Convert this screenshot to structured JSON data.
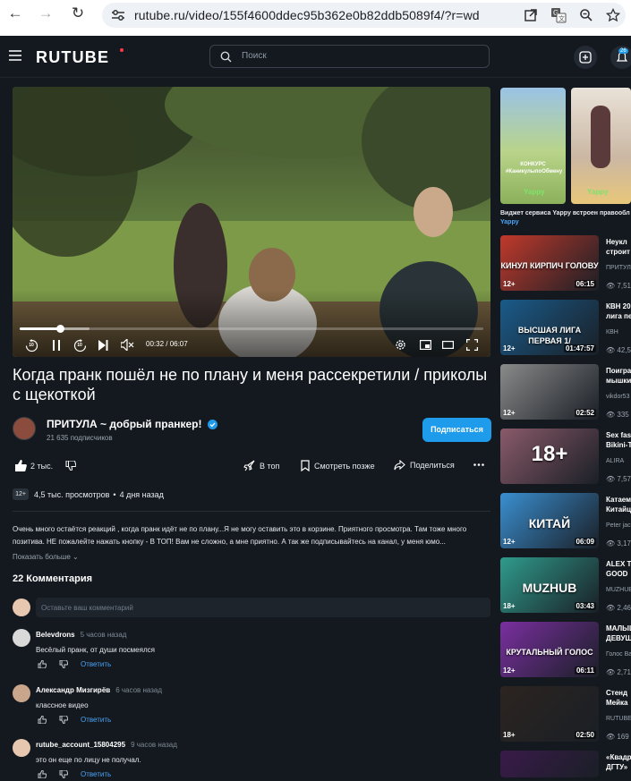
{
  "browser": {
    "url": "rutube.ru/video/155f4600ddec95b362e0b82ddb5089f4/?r=wd"
  },
  "header": {
    "logo": "RUTUBE",
    "search_placeholder": "Поиск",
    "notif_badge": "26"
  },
  "player": {
    "time": "00:32 / 06:07",
    "progress": 0.087,
    "buffer": 0.15,
    "skip_back": "10",
    "skip_fwd": "10"
  },
  "video": {
    "title": "Когда пранк пошёл не по плану и меня рассекретили / приколы с щекоткой",
    "channel": "ПРИТУЛА ~ добрый пранкер!",
    "subscribers": "21 635 подписчиков",
    "subscribe_label": "Подписаться",
    "likes": "2 тыс.",
    "top_label": "В топ",
    "watch_later_label": "Смотреть позже",
    "share_label": "Поделиться",
    "age": "12+",
    "views": "4,5 тыс. просмотров",
    "date": "4 дня назад",
    "description": "Очень много остаётся реакций , когда пранк идёт не по плану...Я не могу оставить это в корзине. Приятного просмотра. Там тоже много позитива. НЕ пожалейте нажать кнопку - В ТОП! Вам не сложно, а мне приятно. А так же подписывайтесь на канал, у меня юмо...",
    "show_more": "Показать больше"
  },
  "comments": {
    "header": "22 Комментария",
    "placeholder": "Оставьте ваш комментарий",
    "reply_label": "Ответить",
    "items": [
      {
        "author": "Belevdrons",
        "time": "5 часов назад",
        "text": "Весёлый пранк, от души посмеялся"
      },
      {
        "author": "Александр Мизгирёв",
        "time": "6 часов назад",
        "text": "классное видео"
      },
      {
        "author": "rutube_account_15804295",
        "time": "9 часов назад",
        "text": "это он еще по лицу не получал."
      }
    ]
  },
  "sidebar": {
    "promo_text": "Виджет сервиса Yappy встроен правообл",
    "promo_link": "Yappy",
    "promo_1_text": "КОНКУРС #КаникулыпоОбмену",
    "promo_brand": "Yappy",
    "items": [
      {
        "title": "Неукл",
        "title2": "строит",
        "channel": "ПРИТУЛ",
        "views": "7,51",
        "age": "12+",
        "duration": "06:15",
        "thumb": "КИНУЛ КИРПИЧ ГОЛОВУ",
        "bg": "#c0392b"
      },
      {
        "title": "КВН 20",
        "title2": "лига пе",
        "channel": "КВН",
        "views": "42,5",
        "age": "12+",
        "duration": "01:47:57",
        "thumb": "ВЫСШАЯ ЛИГА ПЕРВАЯ 1/",
        "bg": "#1a5b8a"
      },
      {
        "title": "Поигра",
        "title2": "мышки",
        "channel": "vikdor53",
        "views": "335",
        "age": "12+",
        "duration": "02:52",
        "thumb": "",
        "bg": "#8a8a8a"
      },
      {
        "title": "Sex fas",
        "title2": "Bikini-T",
        "channel": "ALIRA",
        "views": "7,57",
        "age": "",
        "duration": "",
        "thumb": "18+",
        "bg": "#8a5a6a"
      },
      {
        "title": "Катаем",
        "title2": "Китайц",
        "channel": "Peter jac",
        "views": "3,17",
        "age": "12+",
        "duration": "06:09",
        "thumb": "КИТАЙ",
        "bg": "#3a8fd1"
      },
      {
        "title": "ALEX TA",
        "title2": "GOOD",
        "channel": "MUZHUB",
        "views": "2,46",
        "age": "18+",
        "duration": "03:43",
        "thumb": "MUZHUB",
        "bg": "#2f9b8c"
      },
      {
        "title": "МАЛЫШ",
        "title2": "ДЕВУШ",
        "channel": "Голос Ва",
        "views": "2,71",
        "age": "12+",
        "duration": "06:11",
        "thumb": "КРУТАЛЬНЫЙ ГОЛОС",
        "bg": "#7a2fa0"
      },
      {
        "title": "Стенд",
        "title2": "Мейка",
        "channel": "RUTUBE.",
        "views": "169",
        "age": "18+",
        "duration": "02:50",
        "thumb": "",
        "bg": "#2c2420"
      },
      {
        "title": "«Квадр",
        "title2": "ДГТУ»",
        "channel": "",
        "views": "",
        "age": "",
        "duration": "",
        "thumb": "",
        "bg": "#3a1a4a"
      }
    ]
  },
  "colors": {
    "accent": "#1e9bea",
    "bg": "#14191f",
    "link": "#4ba3f5"
  }
}
